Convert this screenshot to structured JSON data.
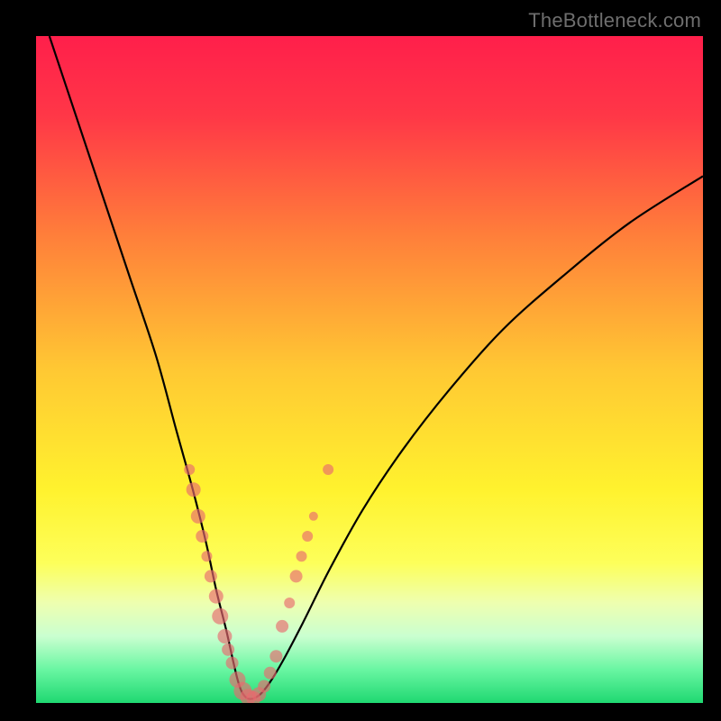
{
  "watermark": "TheBottleneck.com",
  "chart_data": {
    "type": "line",
    "title": "",
    "xlabel": "",
    "ylabel": "",
    "xlim": [
      0,
      100
    ],
    "ylim": [
      0,
      100
    ],
    "gradient_stops": [
      {
        "offset": 0,
        "color": "#ff1f4b"
      },
      {
        "offset": 12,
        "color": "#ff3747"
      },
      {
        "offset": 30,
        "color": "#ff7f3a"
      },
      {
        "offset": 50,
        "color": "#ffc833"
      },
      {
        "offset": 68,
        "color": "#fff22e"
      },
      {
        "offset": 79,
        "color": "#fdff5a"
      },
      {
        "offset": 85,
        "color": "#eeffb0"
      },
      {
        "offset": 90,
        "color": "#caffd0"
      },
      {
        "offset": 95,
        "color": "#69f6a2"
      },
      {
        "offset": 100,
        "color": "#1fd871"
      }
    ],
    "series": [
      {
        "name": "bottleneck-curve",
        "x": [
          2,
          6,
          10,
          14,
          18,
          21,
          23.5,
          25.5,
          27,
          28.5,
          29.5,
          30.3,
          31,
          32,
          33.5,
          35,
          37,
          40,
          44,
          49,
          55,
          62,
          70,
          79,
          89,
          100
        ],
        "y": [
          100,
          88,
          76,
          64,
          52,
          41,
          32,
          24,
          17,
          11,
          6.5,
          3.2,
          1.4,
          0.6,
          1.2,
          3.0,
          6.3,
          12,
          20,
          29,
          38,
          47,
          56,
          64,
          72,
          79
        ]
      }
    ],
    "scatter": {
      "name": "sample-points",
      "points": [
        {
          "x": 23.0,
          "y": 35.0,
          "r": 6
        },
        {
          "x": 23.6,
          "y": 32.0,
          "r": 8
        },
        {
          "x": 24.3,
          "y": 28.0,
          "r": 8
        },
        {
          "x": 24.9,
          "y": 25.0,
          "r": 7
        },
        {
          "x": 25.6,
          "y": 22.0,
          "r": 6
        },
        {
          "x": 26.2,
          "y": 19.0,
          "r": 7
        },
        {
          "x": 27.0,
          "y": 16.0,
          "r": 8
        },
        {
          "x": 27.6,
          "y": 13.0,
          "r": 9
        },
        {
          "x": 28.3,
          "y": 10.0,
          "r": 8
        },
        {
          "x": 28.8,
          "y": 8.0,
          "r": 7
        },
        {
          "x": 29.4,
          "y": 6.0,
          "r": 7
        },
        {
          "x": 30.2,
          "y": 3.5,
          "r": 9
        },
        {
          "x": 31.0,
          "y": 1.8,
          "r": 10
        },
        {
          "x": 31.8,
          "y": 0.9,
          "r": 9
        },
        {
          "x": 32.6,
          "y": 0.7,
          "r": 8
        },
        {
          "x": 33.4,
          "y": 1.3,
          "r": 8
        },
        {
          "x": 34.2,
          "y": 2.5,
          "r": 7
        },
        {
          "x": 35.1,
          "y": 4.5,
          "r": 7
        },
        {
          "x": 36.0,
          "y": 7.0,
          "r": 7
        },
        {
          "x": 36.9,
          "y": 11.5,
          "r": 7
        },
        {
          "x": 38.0,
          "y": 15.0,
          "r": 6
        },
        {
          "x": 39.0,
          "y": 19.0,
          "r": 7
        },
        {
          "x": 39.8,
          "y": 22.0,
          "r": 6
        },
        {
          "x": 40.7,
          "y": 25.0,
          "r": 6
        },
        {
          "x": 41.6,
          "y": 28.0,
          "r": 5
        },
        {
          "x": 43.8,
          "y": 35.0,
          "r": 6
        }
      ]
    }
  }
}
